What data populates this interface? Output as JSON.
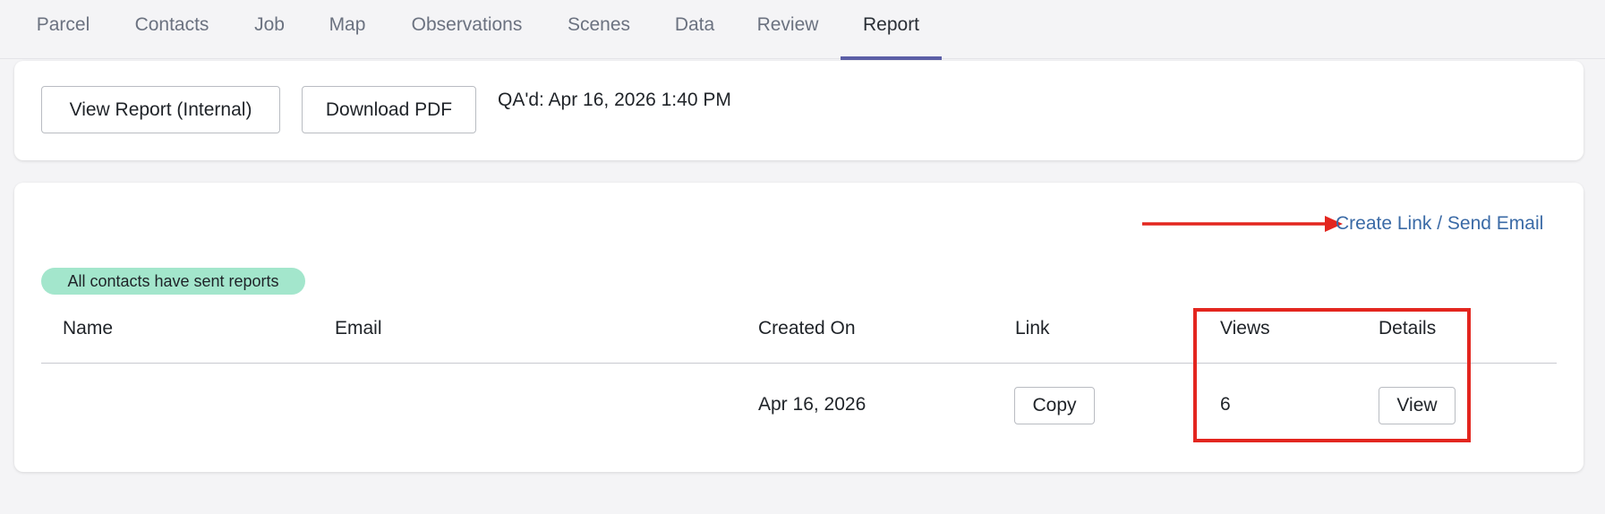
{
  "tabs": [
    {
      "label": "Parcel"
    },
    {
      "label": "Contacts"
    },
    {
      "label": "Job"
    },
    {
      "label": "Map"
    },
    {
      "label": "Observations"
    },
    {
      "label": "Scenes"
    },
    {
      "label": "Data"
    },
    {
      "label": "Review"
    },
    {
      "label": "Report",
      "active": true
    }
  ],
  "report_actions": {
    "view_internal_label": "View Report (Internal)",
    "download_pdf_label": "Download PDF",
    "qa_status": "QA'd: Apr 16, 2026 1:40 PM"
  },
  "links": {
    "create_link_label": "Create Link / Send Email",
    "status_badge": "All contacts have sent reports",
    "columns": [
      "Name",
      "Email",
      "Created On",
      "Link",
      "Views",
      "Details"
    ],
    "rows": [
      {
        "name": "",
        "email": "",
        "created_on": "Apr 16, 2026",
        "link_button": "Copy",
        "views": "6",
        "details_button": "View"
      }
    ]
  },
  "colors": {
    "accent": "#5b5ea6",
    "link": "#3a6aa6",
    "badge": "#a3e6cc",
    "annotation_red": "#e3261f"
  }
}
